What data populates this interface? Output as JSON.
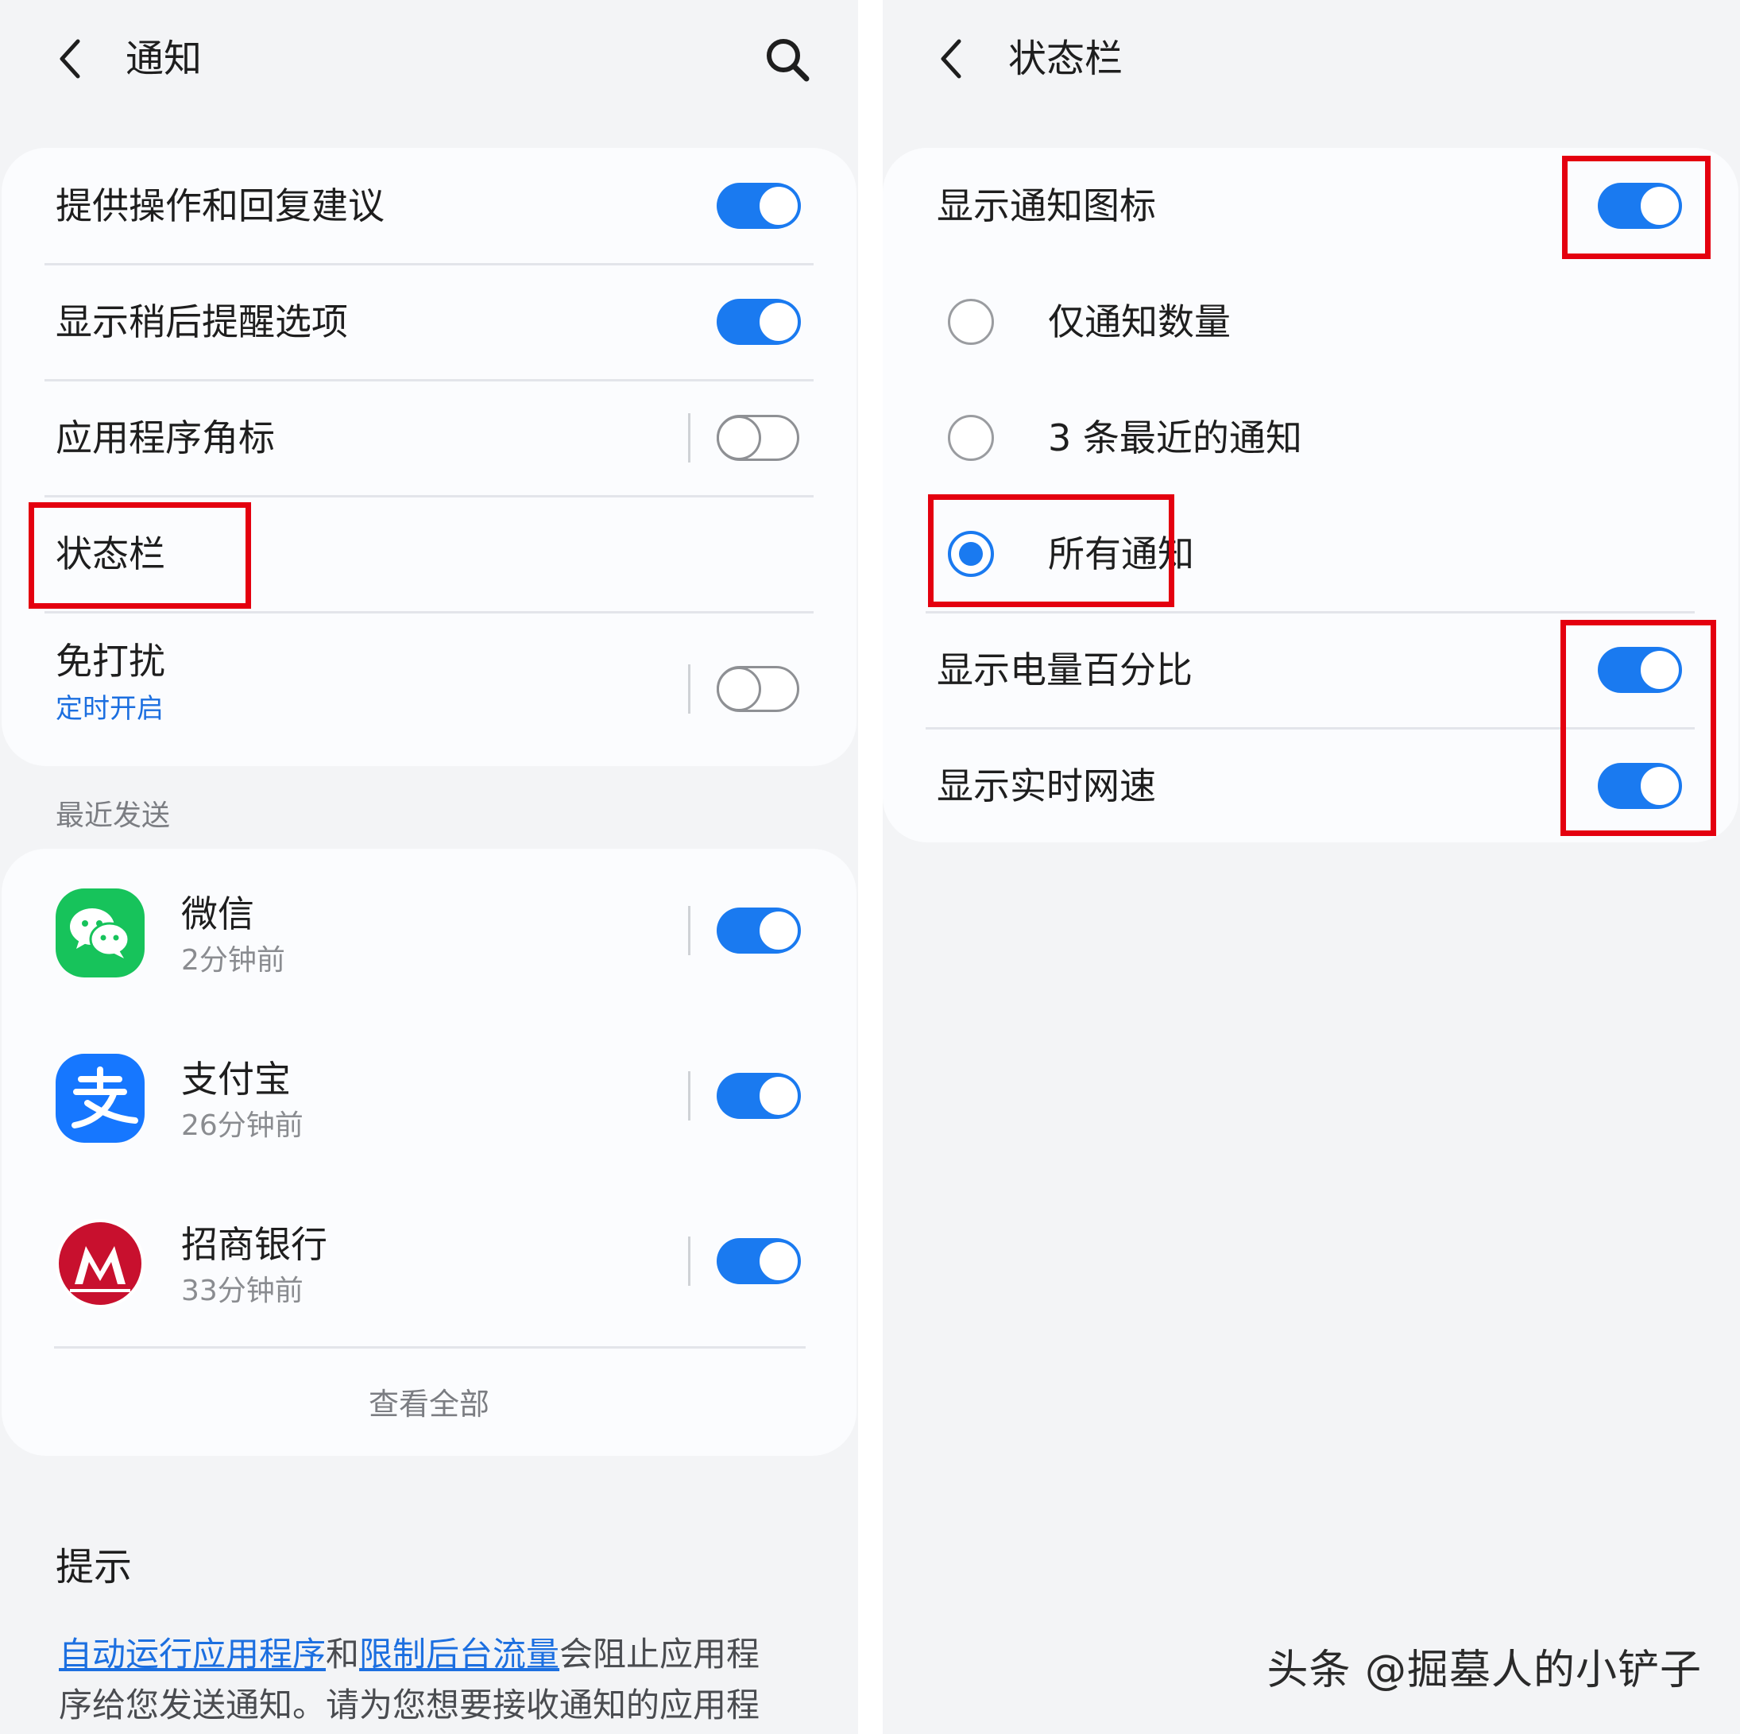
{
  "left": {
    "title": "通知",
    "settings": [
      {
        "label": "提供操作和回复建议",
        "toggle": true
      },
      {
        "label": "显示稍后提醒选项",
        "toggle": true
      },
      {
        "label": "应用程序角标",
        "toggle": false
      },
      {
        "label": "状态栏"
      },
      {
        "label": "免打扰",
        "sub": "定时开启",
        "toggle": false
      }
    ],
    "recent_title": "最近发送",
    "apps": [
      {
        "name": "微信",
        "time": "2分钟前",
        "toggle": true,
        "icon": "wechat-icon",
        "color": "#17c35b"
      },
      {
        "name": "支付宝",
        "time": "26分钟前",
        "toggle": true,
        "icon": "alipay-icon",
        "color": "#1677ff"
      },
      {
        "name": "招商银行",
        "time": "33分钟前",
        "toggle": true,
        "icon": "cmb-icon",
        "color": "#c8102e"
      }
    ],
    "view_all": "查看全部",
    "tip": {
      "title": "提示",
      "link1": "自动运行应用程序",
      "mid1": "和",
      "link2": "限制后台流量",
      "rest": "会阻止应用程序给您发送通知。请为您想要接收通知的应用程"
    }
  },
  "right": {
    "title": "状态栏",
    "show_icons": {
      "label": "显示通知图标",
      "toggle": true
    },
    "radio_options": [
      {
        "label": "仅通知数量",
        "checked": false
      },
      {
        "label": "3 条最近的通知",
        "checked": false
      },
      {
        "label": "所有通知",
        "checked": true
      }
    ],
    "battery": {
      "label": "显示电量百分比",
      "toggle": true
    },
    "netspeed": {
      "label": "显示实时网速",
      "toggle": true
    }
  },
  "watermark": "头条 @掘墓人的小铲子",
  "colors": {
    "accent": "#1a7af0",
    "highlight": "#e4000f",
    "link": "#1c6fe0"
  }
}
